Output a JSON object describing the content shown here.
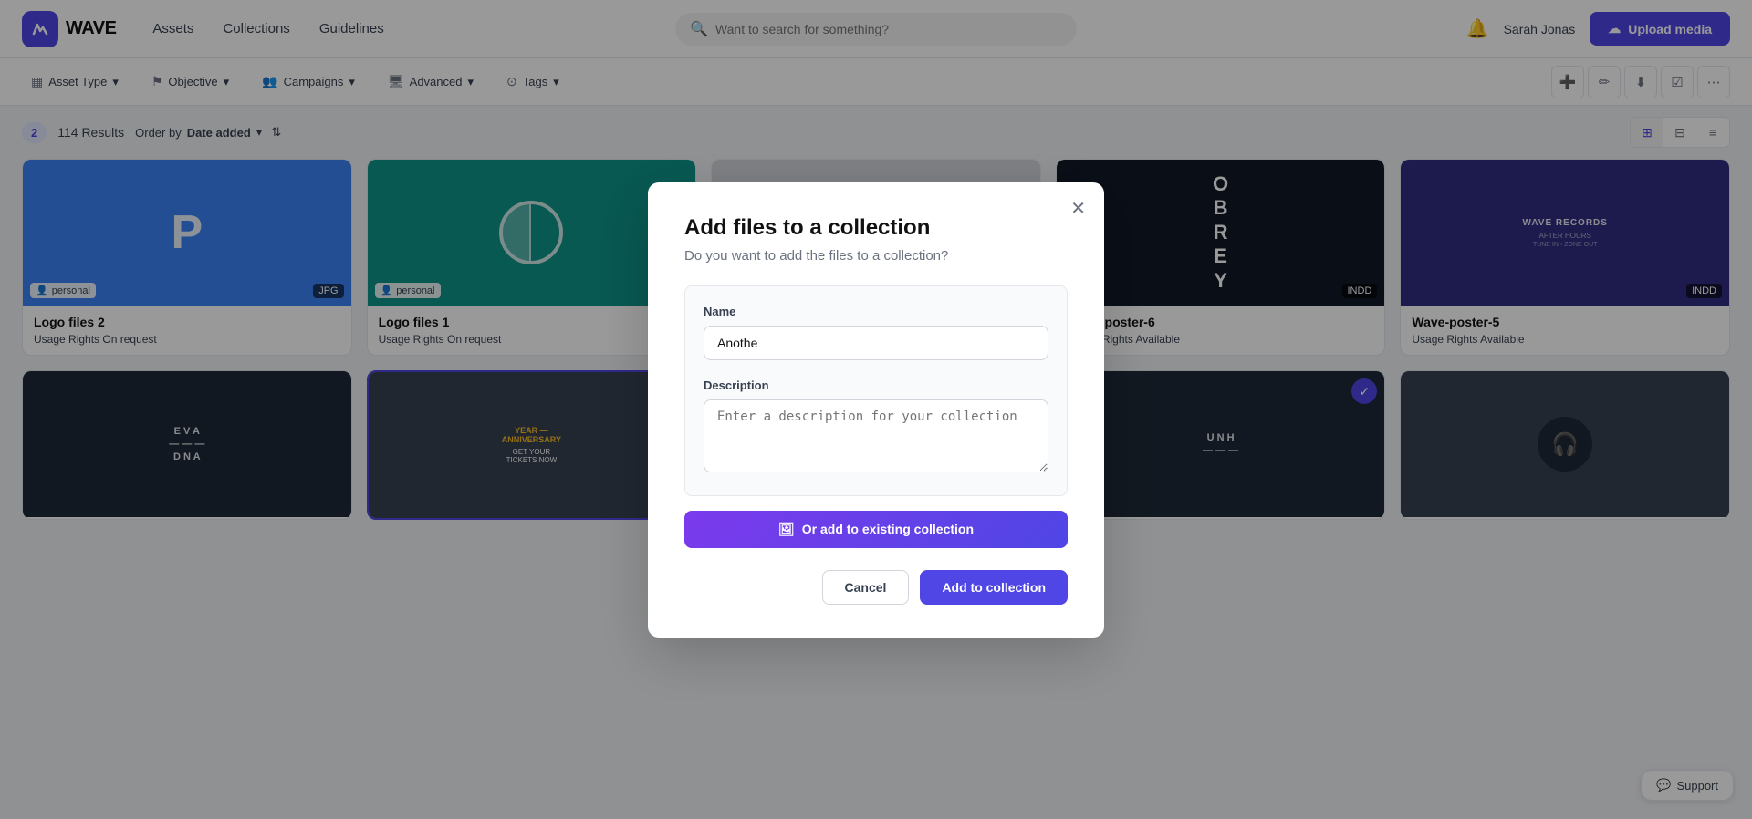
{
  "app": {
    "logo_letter": "W",
    "logo_text": "WAVE"
  },
  "header": {
    "nav": [
      "Assets",
      "Collections",
      "Guidelines"
    ],
    "search_placeholder": "Want to search for something?",
    "user_name": "Sarah Jonas",
    "upload_label": "Upload media"
  },
  "filters": {
    "items": [
      "Asset Type",
      "Objective",
      "Campaigns",
      "Advanced",
      "Tags"
    ],
    "action_icons": [
      "➕",
      "✏️",
      "⬇",
      "☑",
      "⋯"
    ]
  },
  "results": {
    "count": "2",
    "total": "114 Results",
    "order_by_label": "Order by",
    "order_by_value": "Date added",
    "views": [
      "grid",
      "image",
      "list"
    ]
  },
  "assets": [
    {
      "id": "1",
      "title": "Logo files 2",
      "type": "personal",
      "format": "JPG",
      "usage_rights_label": "Usage Rights",
      "usage_rights_value": "On request",
      "thumb_style": "blue",
      "thumb_content": "P"
    },
    {
      "id": "2",
      "title": "Logo files 1",
      "type": "personal",
      "format": "",
      "usage_rights_label": "Usage Rights",
      "usage_rights_value": "On request",
      "thumb_style": "green",
      "thumb_content": "half"
    },
    {
      "id": "3",
      "title": "Wave-poster-6",
      "type": "",
      "format": "INDD",
      "usage_rights_label": "Usage Rights",
      "usage_rights_value": "Available",
      "thumb_style": "dark",
      "thumb_content": "OBREY"
    },
    {
      "id": "4",
      "title": "Wave-poster-5",
      "type": "",
      "format": "INDD",
      "usage_rights_label": "Usage Rights",
      "usage_rights_value": "Available",
      "thumb_style": "purple",
      "thumb_content": "WAVE RECORDS"
    }
  ],
  "bottom_assets": [
    {
      "id": "b1",
      "thumb_style": "dark2",
      "selected": false
    },
    {
      "id": "b2",
      "thumb_style": "event",
      "selected": false
    },
    {
      "id": "b3",
      "thumb_style": "music",
      "selected": false
    },
    {
      "id": "b4",
      "thumb_style": "dark3",
      "selected": true
    },
    {
      "id": "b5",
      "thumb_style": "dark4",
      "selected": false
    }
  ],
  "modal": {
    "title": "Add files to a collection",
    "subtitle": "Do you want to add the files to a collection?",
    "name_label": "Name",
    "name_value": "Anothe",
    "description_label": "Description",
    "description_placeholder": "Enter a description for your collection",
    "or_btn_label": "Or add to existing collection",
    "cancel_label": "Cancel",
    "add_label": "Add to collection"
  },
  "support": {
    "label": "Support"
  }
}
